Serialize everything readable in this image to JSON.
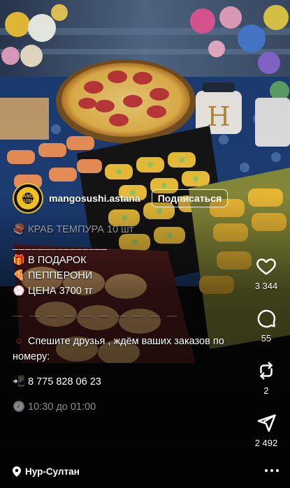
{
  "post": {
    "username": "mangosushi.astana",
    "avatar_text": "MANGO SUSHI",
    "follow_label": "Подписаться",
    "caption": {
      "line1": "КРАБ ТЕМПУРА 10 шт",
      "rule": "_______________",
      "gift": "В ПОДАРОК",
      "gift_icon": "gift-icon",
      "pepperoni": "ПЕППЕРОНИ",
      "pepperoni_icon": "pizza-icon",
      "price": "ЦЕНА 3700 тг",
      "price_icon": "flower-icon",
      "separator": "— — — — — — — — — —",
      "hurry": "Спешите друзья , ждём ваших заказов по номеру:",
      "hurry_icon": "red-circle-icon",
      "phone": "8 775 828 06 23",
      "phone_icon": "phone-arrow-icon",
      "hours": "10:30 до 01:00",
      "hours_icon": "clock-icon"
    },
    "location": "Нур-Султан"
  },
  "actions": {
    "likes": "3 344",
    "comments": "55",
    "reposts": "2",
    "shares": "2 492"
  },
  "colors": {
    "accent_gold": "#f0c020",
    "text": "#ffffff"
  }
}
